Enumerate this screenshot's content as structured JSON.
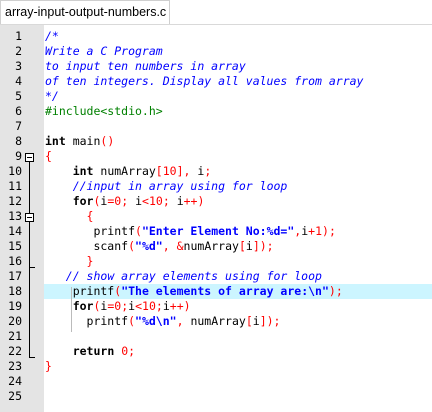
{
  "tab": {
    "label": "array-input-output-numbers.c"
  },
  "colors": {
    "comment": "#0000ff",
    "preprocessor": "#008000",
    "number": "#ff0000",
    "string": "#0000ff",
    "highlight_line_bg": "#ccf5ff",
    "gutter_bg": "#e4e4e4"
  },
  "editor": {
    "current_line": 18,
    "lines": [
      {
        "n": "1",
        "tokens": [
          [
            "cm",
            "/*"
          ]
        ]
      },
      {
        "n": "2",
        "tokens": [
          [
            "cm",
            "Write a C Program"
          ]
        ]
      },
      {
        "n": "3",
        "tokens": [
          [
            "cm",
            "to input ten numbers in array"
          ]
        ]
      },
      {
        "n": "4",
        "tokens": [
          [
            "cm",
            "of ten integers. Display all values from array"
          ]
        ]
      },
      {
        "n": "5",
        "tokens": [
          [
            "cm",
            "*/"
          ]
        ]
      },
      {
        "n": "6",
        "tokens": [
          [
            "pp",
            "#include<stdio.h>"
          ]
        ]
      },
      {
        "n": "7",
        "tokens": []
      },
      {
        "n": "8",
        "tokens": [
          [
            "kw",
            "int"
          ],
          [
            "pl",
            " main"
          ],
          [
            "op",
            "()"
          ]
        ]
      },
      {
        "n": "9",
        "tokens": [
          [
            "op",
            "{"
          ]
        ]
      },
      {
        "n": "10",
        "tokens": [
          [
            "pl",
            "    "
          ],
          [
            "kw",
            "int"
          ],
          [
            "pl",
            " numArray"
          ],
          [
            "op",
            "["
          ],
          [
            "nm",
            "10"
          ],
          [
            "op",
            "],"
          ],
          [
            "pl",
            " i"
          ],
          [
            "op",
            ";"
          ]
        ]
      },
      {
        "n": "11",
        "tokens": [
          [
            "pl",
            "    "
          ],
          [
            "cm",
            "//input in array using for loop"
          ]
        ]
      },
      {
        "n": "12",
        "tokens": [
          [
            "pl",
            "    "
          ],
          [
            "kw",
            "for"
          ],
          [
            "op",
            "("
          ],
          [
            "pl",
            "i"
          ],
          [
            "op",
            "="
          ],
          [
            "nm",
            "0"
          ],
          [
            "op",
            ";"
          ],
          [
            "pl",
            " i"
          ],
          [
            "op",
            "<"
          ],
          [
            "nm",
            "10"
          ],
          [
            "op",
            ";"
          ],
          [
            "pl",
            " i"
          ],
          [
            "op",
            "++)"
          ]
        ]
      },
      {
        "n": "13",
        "tokens": [
          [
            "pl",
            "      "
          ],
          [
            "op",
            "{"
          ]
        ]
      },
      {
        "n": "14",
        "tokens": [
          [
            "pl",
            "       printf"
          ],
          [
            "op",
            "("
          ],
          [
            "st",
            "\"Enter Element No:%d=\""
          ],
          [
            "op",
            ","
          ],
          [
            "pl",
            "i"
          ],
          [
            "op",
            "+"
          ],
          [
            "nm",
            "1"
          ],
          [
            "op",
            ");"
          ]
        ]
      },
      {
        "n": "15",
        "tokens": [
          [
            "pl",
            "       scanf"
          ],
          [
            "op",
            "("
          ],
          [
            "st",
            "\"%d\""
          ],
          [
            "op",
            ","
          ],
          [
            "pl",
            " "
          ],
          [
            "op",
            "&"
          ],
          [
            "pl",
            "numArray"
          ],
          [
            "op",
            "["
          ],
          [
            "pl",
            "i"
          ],
          [
            "op",
            "]);"
          ]
        ]
      },
      {
        "n": "16",
        "tokens": [
          [
            "pl",
            "      "
          ],
          [
            "op",
            "}"
          ]
        ]
      },
      {
        "n": "17",
        "tokens": [
          [
            "pl",
            "   "
          ],
          [
            "cm",
            "// show array elements using for loop"
          ]
        ]
      },
      {
        "n": "18",
        "tokens": [
          [
            "pl",
            "    printf"
          ],
          [
            "op",
            "("
          ],
          [
            "st",
            "\"The elements of array are:\\n\""
          ],
          [
            "op",
            ");"
          ]
        ]
      },
      {
        "n": "19",
        "tokens": [
          [
            "pl",
            "    "
          ],
          [
            "kw",
            "for"
          ],
          [
            "op",
            "("
          ],
          [
            "pl",
            "i"
          ],
          [
            "op",
            "="
          ],
          [
            "nm",
            "0"
          ],
          [
            "op",
            ";"
          ],
          [
            "pl",
            "i"
          ],
          [
            "op",
            "<"
          ],
          [
            "nm",
            "10"
          ],
          [
            "op",
            ";"
          ],
          [
            "pl",
            "i"
          ],
          [
            "op",
            "++)"
          ]
        ]
      },
      {
        "n": "20",
        "tokens": [
          [
            "pl",
            "      printf"
          ],
          [
            "op",
            "("
          ],
          [
            "st",
            "\"%d\\n\""
          ],
          [
            "op",
            ","
          ],
          [
            "pl",
            " numArray"
          ],
          [
            "op",
            "["
          ],
          [
            "pl",
            "i"
          ],
          [
            "op",
            "]);"
          ]
        ]
      },
      {
        "n": "21",
        "tokens": []
      },
      {
        "n": "22",
        "tokens": [
          [
            "pl",
            "    "
          ],
          [
            "kw",
            "return"
          ],
          [
            "pl",
            " "
          ],
          [
            "nm",
            "0"
          ],
          [
            "op",
            ";"
          ]
        ]
      },
      {
        "n": "23",
        "tokens": [
          [
            "op",
            "}"
          ]
        ]
      },
      {
        "n": "24",
        "tokens": []
      },
      {
        "n": "25",
        "tokens": []
      }
    ]
  }
}
